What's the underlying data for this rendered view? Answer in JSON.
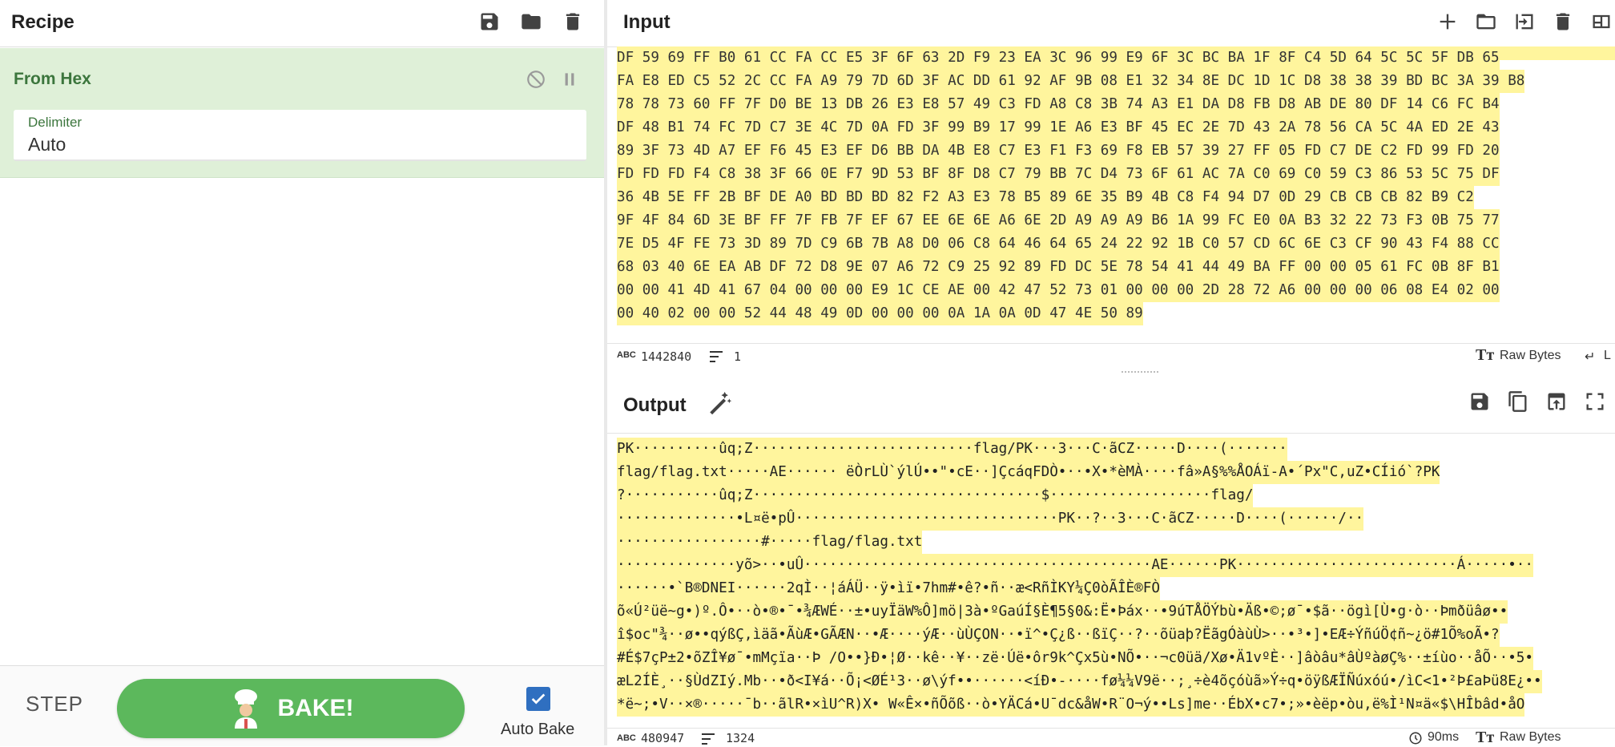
{
  "recipe": {
    "title": "Recipe",
    "icons": [
      "save-icon",
      "folder-icon",
      "trash-icon"
    ],
    "operation": {
      "name": "From Hex",
      "disable_icon": "disable-icon",
      "pause_icon": "pause-icon",
      "arg_label": "Delimiter",
      "arg_value": "Auto"
    },
    "controls": {
      "step_label": "STEP",
      "bake_label": "BAKE!",
      "autobake_label": "Auto Bake",
      "autobake_checked": true
    }
  },
  "input": {
    "title": "Input",
    "icons": [
      "plus-icon",
      "folder-icon",
      "open-file-icon",
      "trash-icon",
      "layout-icon"
    ],
    "hex_lines": [
      "DF 59 69 FF B0 61 CC FA CC E5 3F 6F 63 2D F9 23 EA 3C 96 99 E9 6F 3C BC BA 1F 8F C4 5D 64 5C 5C 5F DB 65",
      "FA E8 ED C5 52 2C CC FA A9 79 7D 6D 3F AC DD 61 92 AF 9B 08 E1 32 34 8E DC 1D 1C D8 38 38 39 BD BC 3A 39 B8",
      "78 78 73 60 FF 7F D0 BE 13 DB 26 E3 E8 57 49 C3 FD A8 C8 3B 74 A3 E1 DA D8 FB D8 AB DE 80 DF 14 C6 FC B4",
      "DF 48 B1 74 FC 7D C7 3E 4C 7D 0A FD 3F 99 B9 17 99 1E A6 E3 BF 45 EC 2E 7D 43 2A 78 56 CA 5C 4A ED 2E 43",
      "89 3F 73 4D A7 EF F6 45 E3 EF D6 BB DA 4B E8 C7 E3 F1 F3 69 F8 EB 57 39 27 FF 05 FD C7 DE C2 FD 99 FD 20",
      "FD FD FD F4 C8 38 3F 66 0E F7 9D 53 BF 8F D8 C7 79 BB 7C D4 73 6F 61 AC 7A C0 69 C0 59 C3 86 53 5C 75 DF",
      "36 4B 5E FF 2B BF DE A0 BD BD BD 82 F2 A3 E3 78 B5 89 6E 35 B9 4B C8 F4 94 D7 0D 29 CB CB CB 82 B9 C2",
      "9F 4F 84 6D 3E BF FF 7F FB 7F EF 67 EE 6E 6E A6 6E 2D A9 A9 A9 B6 1A 99 FC E0 0A B3 32 22 73 F3 0B 75 77",
      "7E D5 4F FE 73 3D 89 7D C9 6B 7B A8 D0 06 C8 64 46 64 65 24 22 92 1B C0 57 CD 6C 6E C3 CF 90 43 F4 88 CC",
      "68 03 40 6E EA AB DF 72 D8 9E 07 A6 72 C9 25 92 89 FD DC 5E 78 54 41 44 49 BA FF 00 00 05 61 FC 0B 8F B1",
      "00 00 41 4D 41 67 04 00 00 00 E9 1C CE AE 00 42 47 52 73 01 00 00 00 2D 28 72 A6 00 00 00 06 08 E4 02 00",
      "00 40 02 00 00 52 44 48 49 0D 00 00 00 0A 1A 0A 0D 47 4E 50 89"
    ],
    "status": {
      "length": "1442840",
      "lines": "1",
      "type": "Raw Bytes",
      "eol_partial": "L"
    }
  },
  "output": {
    "title": "Output",
    "icons": [
      "save-icon",
      "copy-icon",
      "replace-input-icon",
      "maximise-icon"
    ],
    "lines": [
      "PK··········ûq;Z··························flag/PK···3···C·ãCZ·····D····(·······",
      "flag/flag.txt·····AE······ ëÒrLÙ`ýlÚ••\"•cE··]ÇcáqFDÒ•··•X•*èMÀ····fâ»A§%%ÅOÁï-A•´Px\"C,uZ•CÍió`?PK",
      "?···········ûq;Z··································$···················flag/",
      "··············•L¤ë•pÛ·······························PK··?··3···C·ãCZ·····D····(······/··",
      "·················#·····flag/flag.txt",
      "··············yõ>··•uÛ·········································AE······PK··························Á·····•··",
      "······•`B®DNEI······2qÌ··¦áÁÜ··ÿ•ìï•7hm#•ê?•ñ··æ<RñÌKY¼Ç0òÃÎÈ®FÒ",
      "õ«Ú²üë~g•)º.Ô•··ò•®•¯•¾ÆWÉ··±•uyÏäW%Ô]mö|3à•ºGaúÍ§È¶5§0&:Ë•Þáx··•9úTÅÖÝbù•Äß•©;ø¯•$ã··ögì[Ù•g·ò··Þmðüâø••",
      "î$oc\"¾··ø••qýßÇ,ìäã•ÃùÆ•GÃÆN··•Æ····ýÆ··ùÙÇON··•ï^•Ç¿ß··ßïÇ··?··õüaþ?ËãgÓàùÙ>··•³•]•EÆ÷ÝñúÖ¢ñ~¿ö#1Õ%oÃ•?",
      "#É$7çP±2•õZÎ¥ø¯•mMçïa··Þ /O••}Ð•¦Ø··kê··¥··zë·Úë•ôr9k^Çx5ù•NÕ•··¬c0üä/Xø•Ä1vºÈ··]âòâu*âÙºàøÇ%··±íùo··åÕ··•5•",
      "æL2ÍÈ¸··§ÙdZIý.Mb··•ð<I¥á··Õ¡<ØÉ¹3··ø\\ýf••······<íÐ•-····fø¼¼V9ë··;¸÷è4õçóùã»Ý÷q•öÿßÆÏÑúxóú•/ìC<1•²Þ£aÞü8E¿••",
      "*ë~;•V··×®·····¯b··ãlR•×ìU^R)X• W«Ê×•ñÕõß··ò•YÄCá•U¯dc&åW•R¨O¬ý••Ls]me··ÉbX•c7•;»•èëp•òu,ë%Ì¹N¤ä«$\\HÎbâd•åO"
    ],
    "status": {
      "length": "480947",
      "lines": "1324",
      "time": "90ms",
      "type": "Raw Bytes"
    }
  }
}
